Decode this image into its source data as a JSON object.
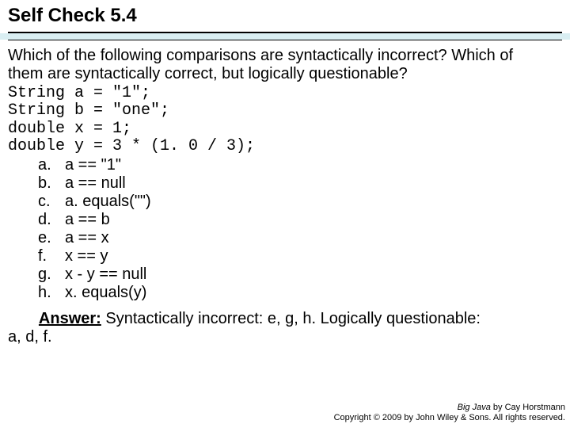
{
  "title": "Self Check 5.4",
  "question_line1": "Which of the following comparisons are syntactically incorrect? Which of",
  "question_line2": "them are syntactically correct, but logically questionable?",
  "code_lines": {
    "l1": "String a = \"1\";",
    "l2": "String b = \"one\";",
    "l3": "double x = 1;",
    "l4": "double y = 3 * (1. 0 / 3);"
  },
  "options": {
    "a": {
      "label": "a.",
      "text": "a == \"1\""
    },
    "b": {
      "label": "b.",
      "text": "a == null"
    },
    "c": {
      "label": "c.",
      "text": "a. equals(\"\")"
    },
    "d": {
      "label": "d.",
      "text": "a == b"
    },
    "e": {
      "label": "e.",
      "text": "a == x"
    },
    "f": {
      "label": "f.",
      "text": "x == y"
    },
    "g": {
      "label": "g.",
      "text": "x - y == null"
    },
    "h": {
      "label": "h.",
      "text": "x. equals(y)"
    }
  },
  "answer": {
    "label": "Answer:",
    "text_tail": " Syntactically incorrect: e, g, h. Logically questionable:",
    "adf": "a, d, f."
  },
  "footer": {
    "book": "Big Java",
    "by": " by Cay Horstmann",
    "copy": "Copyright © 2009 by John Wiley & Sons. All rights reserved."
  }
}
